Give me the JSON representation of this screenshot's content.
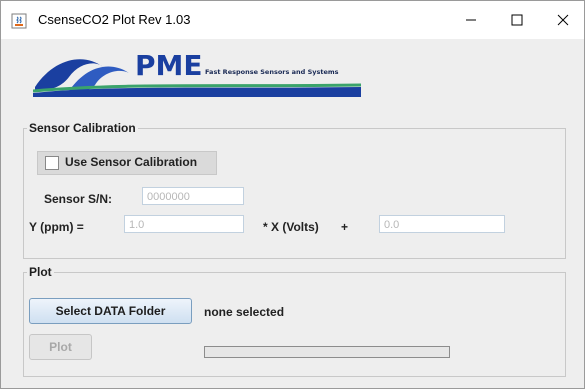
{
  "window": {
    "title": "CsenseCO2 Plot Rev 1.03",
    "icon": "java-icon"
  },
  "logo": {
    "brand": "PME",
    "tagline": "Fast Response Sensors and Systems"
  },
  "calibration": {
    "legend": "Sensor Calibration",
    "use_label": "Use Sensor Calibration",
    "use_checked": false,
    "sn_label": "Sensor S/N:",
    "sn_value": "0000000",
    "y_label": "Y (ppm) =",
    "slope_value": "1.0",
    "x_label": "* X (Volts)",
    "plus": "+",
    "offset_value": "0.0"
  },
  "plot": {
    "legend": "Plot",
    "select_label": "Select DATA Folder",
    "folder_status": "none selected",
    "plot_label": "Plot",
    "progress": 0
  },
  "colors": {
    "window_bg": "#eeeeee",
    "titlebar_bg": "#ffffff",
    "accent": "#7a9ebf",
    "logo_blue": "#1a3fa0",
    "logo_green": "#3aa36b"
  }
}
